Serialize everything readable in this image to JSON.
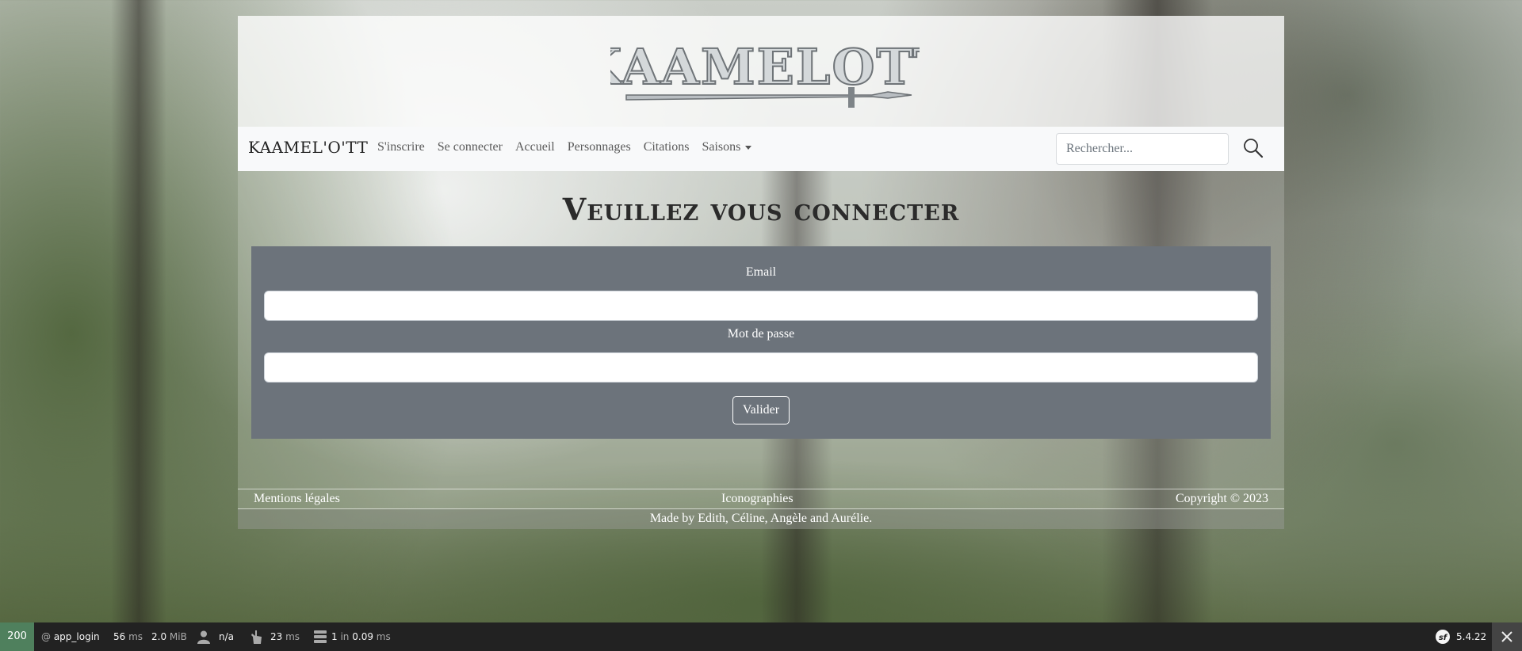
{
  "brand": {
    "name": "KAAMEL'O'TT",
    "logo_text": "KAAMELOTT"
  },
  "nav": {
    "items": [
      {
        "label": "S'inscrire"
      },
      {
        "label": "Se connecter"
      },
      {
        "label": "Accueil"
      },
      {
        "label": "Personnages"
      },
      {
        "label": "Citations"
      },
      {
        "label": "Saisons"
      }
    ],
    "search_placeholder": "Rechercher..."
  },
  "page": {
    "title": "Veuillez vous connecter"
  },
  "form": {
    "email_label": "Email",
    "email_value": "",
    "password_label": "Mot de passe",
    "password_value": "",
    "submit_label": "Valider"
  },
  "footer": {
    "legal": "Mentions légales",
    "iconography": "Iconographies",
    "copyright": "Copyright © 2023",
    "credit": "Made by Edith, Céline, Angèle and Aurélie."
  },
  "debug_toolbar": {
    "status": "200",
    "route": "app_login",
    "time_value": "56",
    "time_unit": "ms",
    "memory_value": "2.0",
    "memory_unit": "MiB",
    "user": "n/a",
    "init_value": "23",
    "init_unit": "ms",
    "db_count": "1",
    "db_in": "in",
    "db_time": "0.09",
    "db_unit": "ms",
    "version": "5.4.22",
    "icons": [
      "person-icon",
      "hand-pointer-icon",
      "database-icon",
      "symfony-logo-icon",
      "close-icon"
    ]
  },
  "colors": {
    "form_panel": "#6c737b",
    "navbar": "#f8f9fa",
    "toolbar": "#222222",
    "status_ok": "#4f805d"
  }
}
